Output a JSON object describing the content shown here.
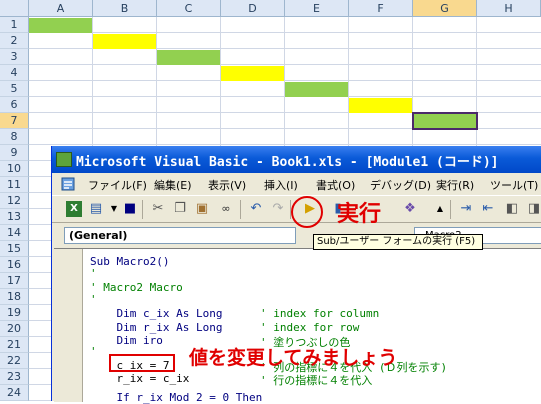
{
  "sheet": {
    "columns": [
      "A",
      "B",
      "C",
      "D",
      "E",
      "F",
      "G",
      "H"
    ],
    "selected_column": "G",
    "rows": [
      "1",
      "2",
      "3",
      "4",
      "5",
      "6",
      "7",
      "8",
      "9",
      "10",
      "11",
      "12",
      "13",
      "14",
      "15",
      "16",
      "17",
      "18",
      "19",
      "20",
      "21",
      "22",
      "23",
      "24"
    ],
    "selected_row": "7",
    "green": "#92d050",
    "yellow": "#ffff00"
  },
  "vbe": {
    "title": "Microsoft Visual Basic - Book1.xls - [Module1 (コード)]",
    "menus": [
      "ファイル(F)",
      "編集(E)",
      "表示(V)",
      "挿入(I)",
      "書式(O)",
      "デバッグ(D)",
      "実行(R)",
      "ツール(T)"
    ],
    "object_combo": "(General)",
    "proc_combo": "Macro2",
    "tooltip": "Sub/ユーザー フォームの実行 (F5)",
    "code": {
      "l1": "Sub Macro2()",
      "l2": "'",
      "l3": "' Macro2 Macro",
      "l4": "'",
      "l5a": "    Dim c_ix As Long",
      "l5b": "' index for column",
      "l6a": "    Dim r_ix As Long",
      "l6b": "' index for row",
      "l7a": "    Dim iro",
      "l7b": "' 塗りつぶしの色",
      "l8": "'",
      "l9a": "    c_ix = 7",
      "l9b": "' 列の指標に４を代入 (Ｄ列を示す)",
      "l10a": "    r_ix = c_ix",
      "l10b": "' 行の指標に４を代入",
      "l11": "    If r_ix Mod 2 = 0 Then"
    }
  },
  "annotations": {
    "run_label": "実行",
    "change_note": "値を変更してみましょう"
  }
}
